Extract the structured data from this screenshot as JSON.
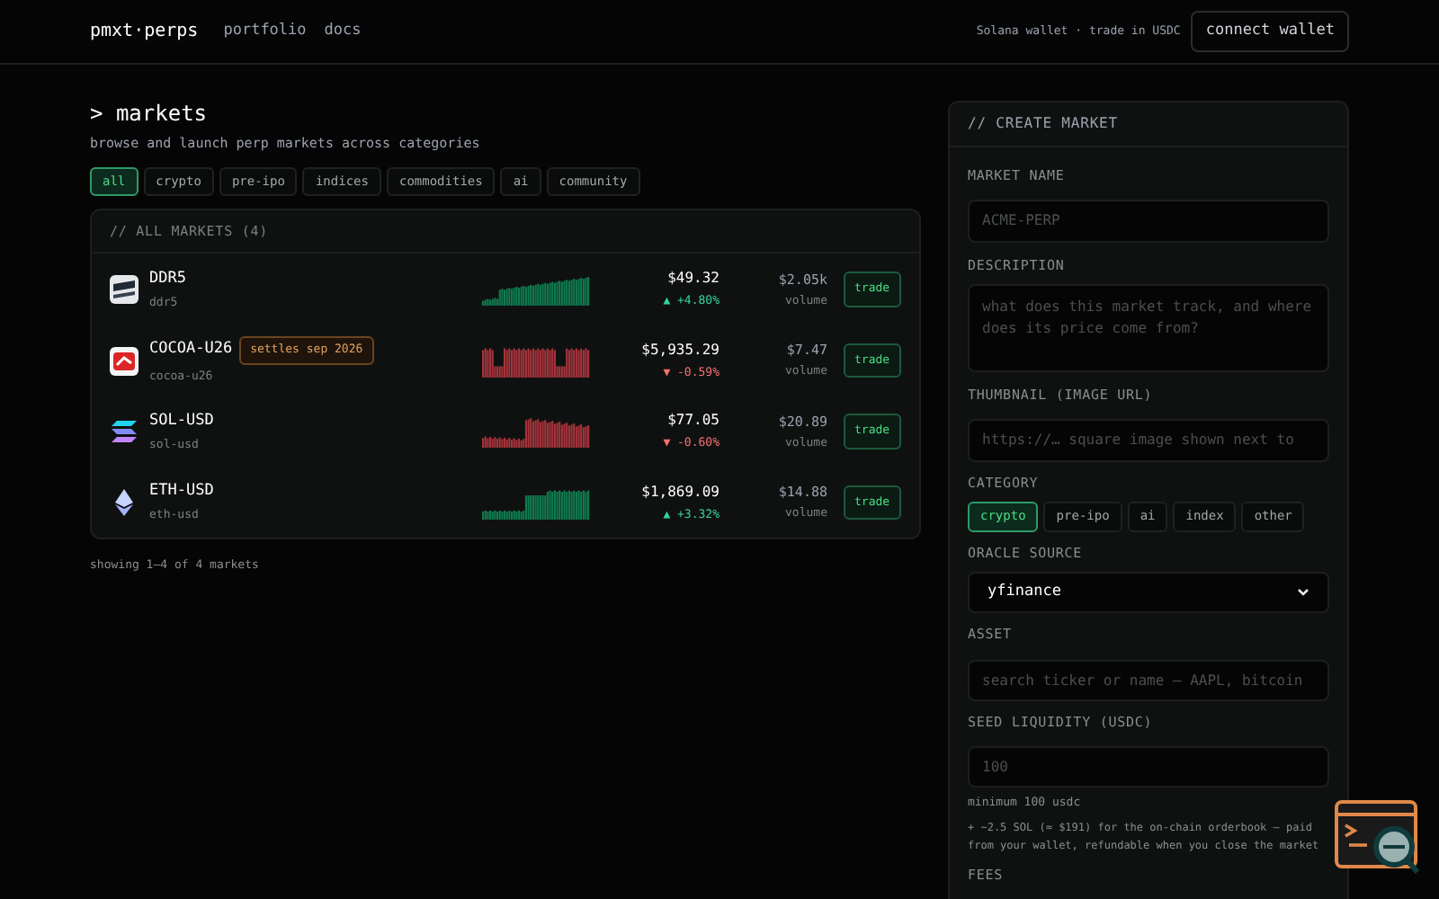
{
  "nav": {
    "brand": "pmxt·perps",
    "links": [
      "portfolio",
      "docs"
    ],
    "wallet_note": "Solana wallet · trade in USDC",
    "connect_button": "connect wallet"
  },
  "page": {
    "title": "> markets",
    "subtitle": "browse and launch perp markets across categories"
  },
  "filters": [
    {
      "label": "all",
      "selected": true
    },
    {
      "label": "crypto",
      "selected": false
    },
    {
      "label": "pre-ipo",
      "selected": false
    },
    {
      "label": "indices",
      "selected": false
    },
    {
      "label": "commodities",
      "selected": false
    },
    {
      "label": "ai",
      "selected": false
    },
    {
      "label": "community",
      "selected": false
    }
  ],
  "markets_table": {
    "title": "// ALL MARKETS (4)",
    "rows": [
      {
        "name": "DDR5",
        "symbol": "ddr5",
        "price": "$49.32",
        "change": "▲ +4.80%",
        "rising": true,
        "volume": "$2.05k",
        "volume_label": "volume",
        "button": "trade"
      },
      {
        "name": "COCOA-U26",
        "badge": "settles sep 2026",
        "symbol": "cocoa-u26",
        "price": "$5,935.29",
        "change": "▼ -0.59%",
        "rising": false,
        "volume": "$7.47",
        "volume_label": "volume",
        "button": "trade"
      },
      {
        "name": "SOL-USD",
        "symbol": "sol-usd",
        "price": "$77.05",
        "change": "▼ -0.60%",
        "rising": false,
        "volume": "$20.89",
        "volume_label": "volume",
        "button": "trade"
      },
      {
        "name": "ETH-USD",
        "symbol": "eth-usd",
        "price": "$1,869.09",
        "change": "▲ +3.32%",
        "rising": true,
        "volume": "$14.88",
        "volume_label": "volume",
        "button": "trade"
      }
    ],
    "footer": "showing 1–4 of 4 markets"
  },
  "create_market": {
    "title": "// CREATE MARKET",
    "market_name": {
      "label": "MARKET NAME",
      "placeholder": "ACME-PERP"
    },
    "description": {
      "label": "DESCRIPTION",
      "placeholder": "what does this market track, and where does its price come from?"
    },
    "thumbnail": {
      "label": "THUMBNAIL (IMAGE URL)",
      "placeholder": "https://… square image shown next to"
    },
    "category": {
      "label": "CATEGORY",
      "options": [
        {
          "label": "crypto",
          "selected": true
        },
        {
          "label": "pre-ipo",
          "selected": false
        },
        {
          "label": "ai",
          "selected": false
        },
        {
          "label": "index",
          "selected": false
        },
        {
          "label": "other",
          "selected": false
        }
      ]
    },
    "oracle_source": {
      "label": "ORACLE SOURCE",
      "value": "yfinance"
    },
    "asset": {
      "label": "ASSET",
      "placeholder": "search ticker or name — AAPL, bitcoin"
    },
    "seed_liquidity": {
      "label": "SEED LIQUIDITY (USDC)",
      "placeholder": "100",
      "hint": "minimum 100 usdc"
    },
    "note": "+ ~2.5 SOL (≈ $191) for the on-chain orderbook — paid from your wallet, refundable when you close the market",
    "fees_label": "FEES"
  }
}
